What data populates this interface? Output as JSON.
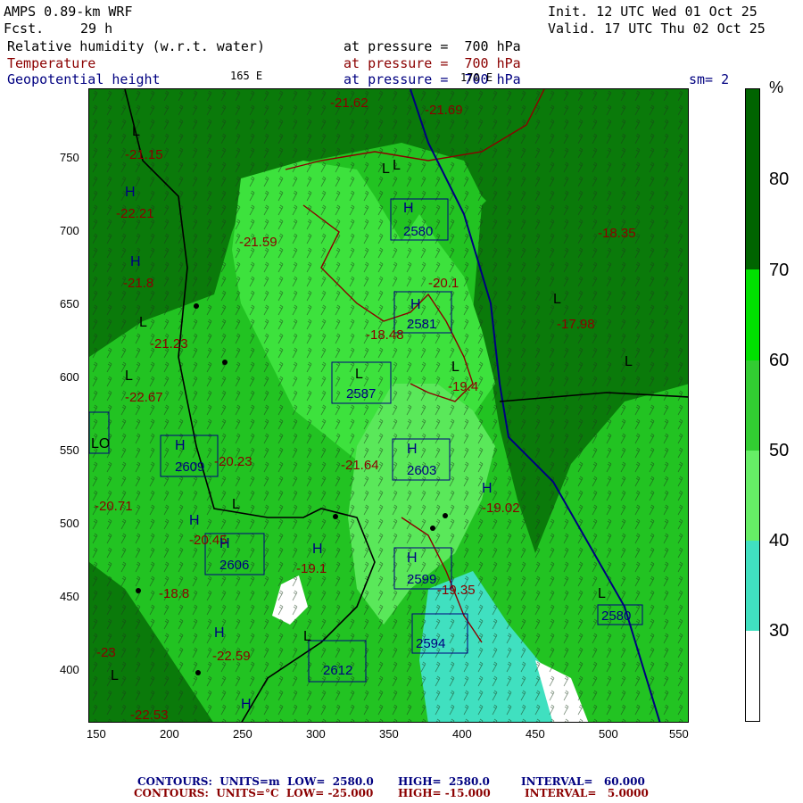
{
  "header": {
    "model": "AMPS 0.89-km WRF",
    "init": "Init. 12 UTC Wed 01 Oct 25",
    "fcst_label": "Fcst.",
    "fcst_hours": "29 h",
    "valid": "Valid. 17 UTC Thu 02 Oct 25",
    "field1": "Relative humidity (w.r.t. water)",
    "field1_level": "at pressure =  700 hPa",
    "field2": "Temperature",
    "field2_level": "at pressure =  700 hPa",
    "field3": "Geopotential height",
    "field3_level": "at pressure =  700 hPa",
    "lon_165e": "165 E",
    "lon_170e": "170 E",
    "sm": "sm= 2"
  },
  "axes": {
    "x_ticks": [
      "150",
      "200",
      "250",
      "300",
      "350",
      "400",
      "450",
      "500",
      "550"
    ],
    "y_ticks": [
      "750",
      "700",
      "650",
      "600",
      "550",
      "500",
      "450",
      "400"
    ]
  },
  "colorbar": {
    "unit": "%",
    "labels": [
      "80",
      "70",
      "60",
      "50",
      "40",
      "30"
    ],
    "colors": [
      "#006400",
      "#00e000",
      "#32cd32",
      "#66ee66",
      "#40e0c0",
      "#ffffff"
    ]
  },
  "map_labels": {
    "temps": [
      "-21.62",
      "-21.69",
      "-21.15",
      "-22.21",
      "-21.59",
      "-21.8",
      "-21.23",
      "-22.67",
      "-18.48",
      "-19.4",
      "-20.23",
      "-21.64",
      "-20.45",
      "-19.1",
      "-18.8",
      "-22.59",
      "-22.53",
      "-18.35",
      "-17.98",
      "-19.02",
      "-20.1",
      "-20.71",
      "-19.35",
      "-23"
    ],
    "heights": [
      "2580",
      "2581",
      "2587",
      "2609",
      "2603",
      "2606",
      "2599",
      "2594",
      "2612",
      "2580"
    ],
    "highs": [
      "H",
      "H",
      "H",
      "H",
      "H",
      "H",
      "H",
      "H",
      "H",
      "H",
      "H",
      "H",
      "H"
    ],
    "lows": [
      "L",
      "L",
      "L",
      "L",
      "L",
      "L",
      "L",
      "L",
      "L",
      "L",
      "L",
      "L"
    ],
    "box_l": "L",
    "box_lo": "LO"
  },
  "footer": {
    "line1_a": "CONTOURS:  UNITS=m  LOW=  2580.0",
    "line1_b": "HIGH=  2580.0",
    "line1_c": "INTERVAL=   60.000",
    "line2_a": "CONTOURS:  UNITS=°C  LOW= -25.000",
    "line2_b": "HIGH= -15.000",
    "line2_c": "INTERVAL=   5.0000"
  }
}
